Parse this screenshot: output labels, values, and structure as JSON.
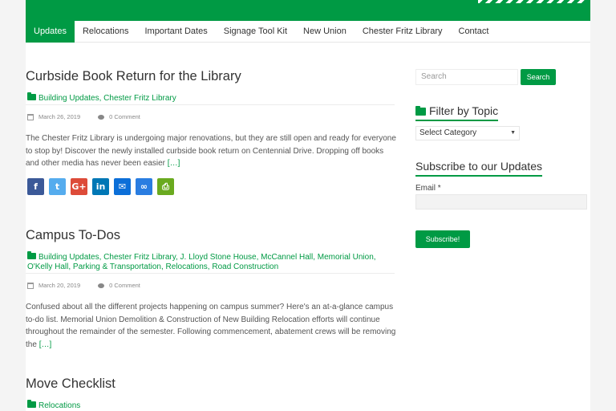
{
  "nav": {
    "items": [
      {
        "label": "Updates",
        "active": true
      },
      {
        "label": "Relocations"
      },
      {
        "label": "Important Dates"
      },
      {
        "label": "Signage Tool Kit"
      },
      {
        "label": "New Union"
      },
      {
        "label": "Chester Fritz Library"
      },
      {
        "label": "Contact"
      }
    ]
  },
  "posts": [
    {
      "title": "Curbside Book Return for the Library",
      "categories": "Building Updates, Chester Fritz Library",
      "date": "March 26, 2019",
      "comments": "0 Comment",
      "excerpt": "The Chester Fritz Library is undergoing major renovations, but they are still open and ready for everyone to stop by! Discover the newly installed curbside book return on Centennial Drive. Dropping off books and other media has never been easier",
      "more": "[…]"
    },
    {
      "title": "Campus To-Dos",
      "categories": "Building Updates, Chester Fritz Library, J. Lloyd Stone House, McCannel Hall, Memorial Union, O'Kelly Hall, Parking & Transportation, Relocations, Road Construction",
      "date": "March 20, 2019",
      "comments": "0 Comment",
      "excerpt": "Confused about all the different projects happening on campus summer? Here's an at-a-glance campus to-do list. Memorial Union Demolition & Construction of New Building Relocation efforts will continue throughout the remainder of the semester. Following commencement, abatement crews will be removing the",
      "more": "[…]"
    },
    {
      "title": "Move Checklist",
      "categories": "Relocations"
    }
  ],
  "share": [
    {
      "name": "facebook",
      "glyph": "f",
      "color": "#3b5998"
    },
    {
      "name": "twitter",
      "glyph": "t",
      "color": "#55acee"
    },
    {
      "name": "google-plus",
      "glyph": "G+",
      "color": "#dd4b39"
    },
    {
      "name": "linkedin",
      "glyph": "in",
      "color": "#0077b5"
    },
    {
      "name": "email",
      "glyph": "✉",
      "color": "#0c6fd8"
    },
    {
      "name": "link",
      "glyph": "∞",
      "color": "#2a7de1"
    },
    {
      "name": "print",
      "glyph": "⎙",
      "color": "#6aaa1f"
    }
  ],
  "sidebar": {
    "search_placeholder": "Search",
    "search_button": "Search",
    "filter_title": "Filter by Topic",
    "select_value": "Select Category",
    "subscribe_title": "Subscribe to our Updates",
    "email_label": "Email *",
    "subscribe_button": "Subscribe!"
  },
  "colors": {
    "accent": "#009a44"
  }
}
